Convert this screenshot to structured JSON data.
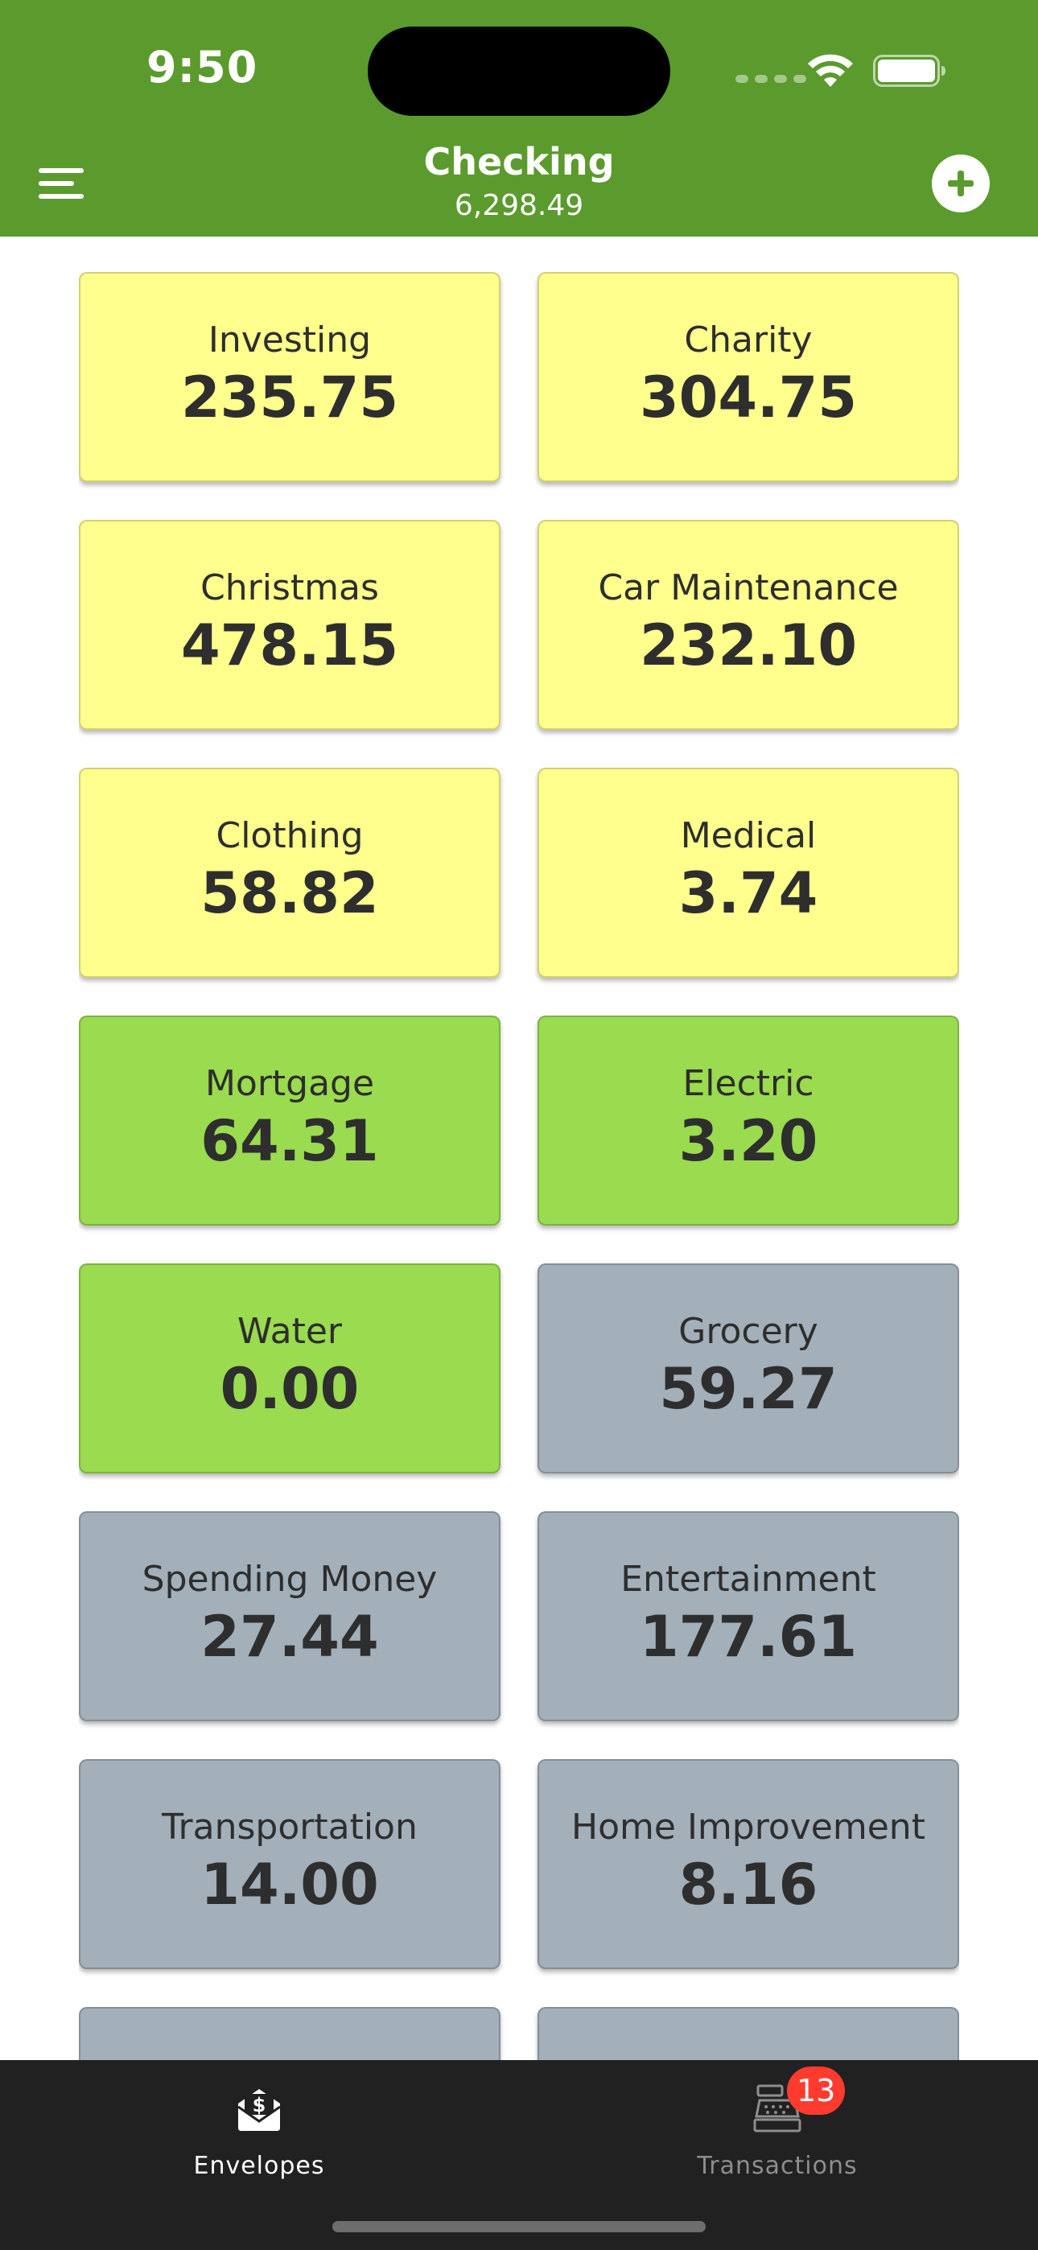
{
  "status_bar": {
    "time": "9:50"
  },
  "nav": {
    "title": "Checking",
    "subtitle": "6,298.49"
  },
  "colors": {
    "header_green": "#5b9b2d",
    "card_yellow": "#ffff8d",
    "card_green": "#9adb4f",
    "card_gray": "#a3afb9",
    "tab_bar": "#212121",
    "badge_red": "#ff3b30"
  },
  "envelopes": [
    {
      "name": "Investing",
      "amount": "235.75",
      "color": "yellow"
    },
    {
      "name": "Charity",
      "amount": "304.75",
      "color": "yellow"
    },
    {
      "name": "Christmas",
      "amount": "478.15",
      "color": "yellow"
    },
    {
      "name": "Car Maintenance",
      "amount": "232.10",
      "color": "yellow"
    },
    {
      "name": "Clothing",
      "amount": "58.82",
      "color": "yellow"
    },
    {
      "name": "Medical",
      "amount": "3.74",
      "color": "yellow"
    },
    {
      "name": "Mortgage",
      "amount": "64.31",
      "color": "green"
    },
    {
      "name": "Electric",
      "amount": "3.20",
      "color": "green"
    },
    {
      "name": "Water",
      "amount": "0.00",
      "color": "green"
    },
    {
      "name": "Grocery",
      "amount": "59.27",
      "color": "gray"
    },
    {
      "name": "Spending Money",
      "amount": "27.44",
      "color": "gray"
    },
    {
      "name": "Entertainment",
      "amount": "177.61",
      "color": "gray"
    },
    {
      "name": "Transportation",
      "amount": "14.00",
      "color": "gray"
    },
    {
      "name": "Home Improvement",
      "amount": "8.16",
      "color": "gray"
    },
    {
      "name": "",
      "amount": "",
      "color": "gray"
    },
    {
      "name": "",
      "amount": "",
      "color": "gray"
    }
  ],
  "tabs": [
    {
      "label": "Envelopes",
      "icon": "envelope-dollar-icon",
      "active": true
    },
    {
      "label": "Transactions",
      "icon": "cash-register-icon",
      "active": false,
      "badge": "13"
    }
  ]
}
